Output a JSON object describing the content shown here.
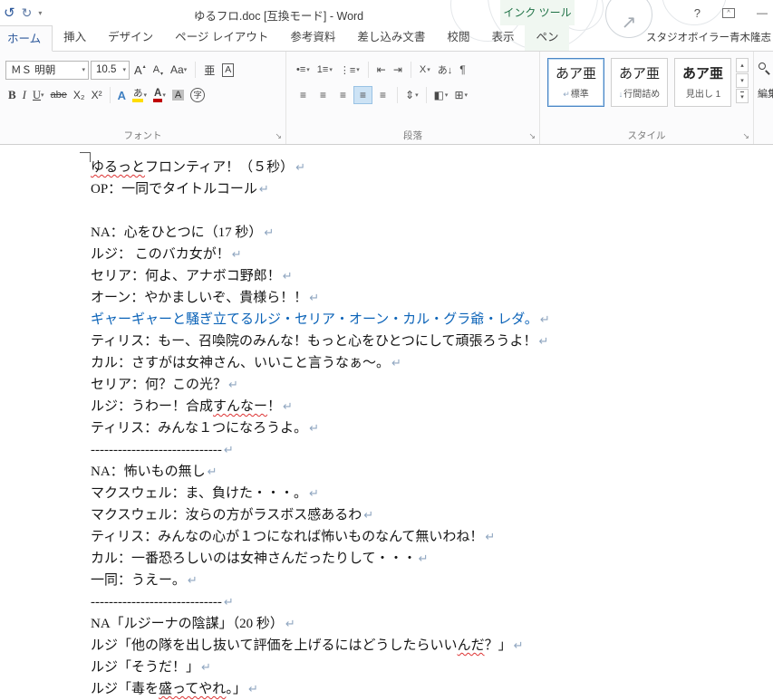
{
  "colors": {
    "accent_blue": "#2b579a",
    "context_green": "#1e7145",
    "document_text_blue": "#0b63b8",
    "spellcheck_red": "#dd3333",
    "paragraph_mark_blue": "#8fa6c0",
    "highlight_yellow": "#ffdd00",
    "font_color_red": "#c00000"
  },
  "title_bar": {
    "quick_access": {
      "undo": "↺",
      "redo": "↻",
      "customize": "▾"
    },
    "title": "ゆるフロ.doc [互換モード] - Word",
    "context_header": "インク ツール",
    "decor_arrow": "↗",
    "help": "?",
    "ribbon_options": "^",
    "minimize": "—"
  },
  "tab_bar": {
    "tabs": [
      {
        "label": "ホーム",
        "active": true
      },
      {
        "label": "挿入"
      },
      {
        "label": "デザイン"
      },
      {
        "label": "ページ レイアウト"
      },
      {
        "label": "参考資料"
      },
      {
        "label": "差し込み文書"
      },
      {
        "label": "校閲"
      },
      {
        "label": "表示"
      },
      {
        "label": "ペン",
        "contextual": true
      }
    ],
    "account": "スタジオボイラー青木隆志"
  },
  "ribbon": {
    "dd": "▾",
    "up": "▴",
    "dialog_launcher": "↘",
    "font": {
      "group_label": "フォント",
      "font_name": "ＭＳ 明朝",
      "font_size": "10.5",
      "grow_font": "A",
      "shrink_font": "A",
      "change_case": "Aa",
      "ruby": "亜",
      "enclose_border": "A",
      "bold": "B",
      "italic": "I",
      "underline": "U",
      "strikethrough": "abe",
      "subscript": "X₂",
      "superscript": "X²",
      "text_effects": "A",
      "highlight": "あ",
      "font_color": "A",
      "char_shading": "A",
      "enclose_char": "字"
    },
    "paragraph": {
      "group_label": "段落",
      "bullets": "•≡",
      "numbering": "1≡",
      "multilevel": "⋮≡",
      "outdent": "⇤",
      "indent": "⇥",
      "asian_format": "X",
      "sort": "あ↓",
      "show_marks": "¶",
      "align_left": "≡",
      "align_center": "≡",
      "align_right": "≡",
      "justify": "≡",
      "distribute": "≡",
      "line_spacing": "⇕",
      "shading": "◧",
      "borders": "⊞"
    },
    "styles": {
      "group_label": "スタイル",
      "items": [
        {
          "preview": "あア亜",
          "prefix": "↵",
          "name": "標準",
          "selected": true
        },
        {
          "preview": "あア亜",
          "prefix": "↓",
          "name": "行間詰め"
        },
        {
          "preview": "あア亜",
          "prefix": "",
          "name": "見出し 1"
        }
      ],
      "scroll_up": "▴",
      "scroll_down": "▾",
      "more": "▾"
    },
    "editing": {
      "group_label": "編集"
    }
  },
  "document": {
    "paragraph_mark": "↵",
    "lines": [
      {
        "seg": [
          {
            "t": "ゆるっと",
            "sp": true
          },
          {
            "t": "フロンティア！（５秒）"
          }
        ]
      },
      {
        "seg": [
          {
            "t": "OP：一同でタイトルコール"
          }
        ]
      },
      {
        "seg": [],
        "m": false
      },
      {
        "seg": [
          {
            "t": "NA：心をひとつに（17 秒）"
          }
        ]
      },
      {
        "seg": [
          {
            "t": "ルジ： このバカ女が！"
          }
        ]
      },
      {
        "seg": [
          {
            "t": "セリア：何よ、アナボコ野郎！"
          }
        ]
      },
      {
        "seg": [
          {
            "t": "オーン：やかましいぞ、貴様ら！！"
          }
        ]
      },
      {
        "seg": [
          {
            "t": "ギャーギャーと騒ぎ立てるルジ・セリア・オーン・カル・グラ爺・レダ。",
            "c": "blue"
          }
        ]
      },
      {
        "seg": [
          {
            "t": "ティリス：もー、召喚院のみんな！もっと心をひとつにして頑張ろうよ！"
          }
        ]
      },
      {
        "seg": [
          {
            "t": "カル：さすがは女神さん、いいこと言うなぁ～。"
          }
        ]
      },
      {
        "seg": [
          {
            "t": "セリア：何？この光？"
          }
        ]
      },
      {
        "seg": [
          {
            "t": "ルジ：うわー！合成"
          },
          {
            "t": "すんなー",
            "sp": true
          },
          {
            "t": "！"
          }
        ]
      },
      {
        "seg": [
          {
            "t": "ティリス：みんな１つになろうよ。"
          }
        ]
      },
      {
        "seg": [
          {
            "t": "-----------------------------"
          }
        ]
      },
      {
        "seg": [
          {
            "t": "NA：怖いもの無し"
          }
        ]
      },
      {
        "seg": [
          {
            "t": "マクスウェル：ま、負けた・・・。"
          }
        ]
      },
      {
        "seg": [
          {
            "t": "マクスウェル：汝らの方がラスボス感あるわ"
          }
        ]
      },
      {
        "seg": [
          {
            "t": "ティリス：みんなの心が１つになれば怖いものなんて無いわね！"
          }
        ]
      },
      {
        "seg": [
          {
            "t": "カル：一番恐ろしいのは女神さんだったりして・・・"
          }
        ]
      },
      {
        "seg": [
          {
            "t": "一同：うえー。"
          }
        ]
      },
      {
        "seg": [
          {
            "t": "-----------------------------"
          }
        ]
      },
      {
        "seg": [
          {
            "t": "NA「ルジーナの陰謀」（20 秒）"
          }
        ]
      },
      {
        "seg": [
          {
            "t": "ルジ「他の隊を出し抜いて評価を上げるにはどうしたらいい"
          },
          {
            "t": "んだ",
            "sp": true
          },
          {
            "t": "？」"
          }
        ]
      },
      {
        "seg": [
          {
            "t": "ルジ「そうだ！」"
          }
        ]
      },
      {
        "seg": [
          {
            "t": "ルジ「毒を"
          },
          {
            "t": "盛ってやれ",
            "sp": true
          },
          {
            "t": "。」"
          }
        ]
      }
    ]
  }
}
